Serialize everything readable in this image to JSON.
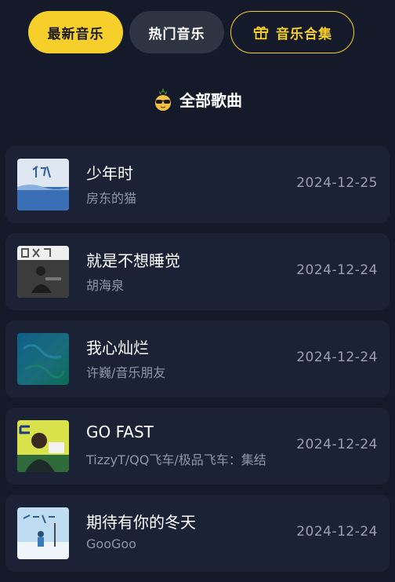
{
  "tabs": [
    {
      "label": "最新音乐"
    },
    {
      "label": "热门音乐"
    },
    {
      "label": "音乐合集",
      "icon": "gift-icon"
    }
  ],
  "section": {
    "title": "全部歌曲",
    "icon": "sunglasses-pineapple-emoji"
  },
  "colors": {
    "accent": "#f7cf2b",
    "background": "#141a2a",
    "card": "#1b2236"
  },
  "songs": [
    {
      "title": "少年时",
      "artist": "房东的猫",
      "date": "2024-12-25"
    },
    {
      "title": "就是不想睡觉",
      "artist": "胡海泉",
      "date": "2024-12-24"
    },
    {
      "title": "我心灿烂",
      "artist": "许巍/音乐朋友",
      "date": "2024-12-24"
    },
    {
      "title": "GO FAST",
      "artist": "TizzyT/QQ飞车/极品飞车：集结",
      "date": "2024-12-24"
    },
    {
      "title": "期待有你的冬天",
      "artist": "GooGoo",
      "date": "2024-12-24"
    }
  ]
}
